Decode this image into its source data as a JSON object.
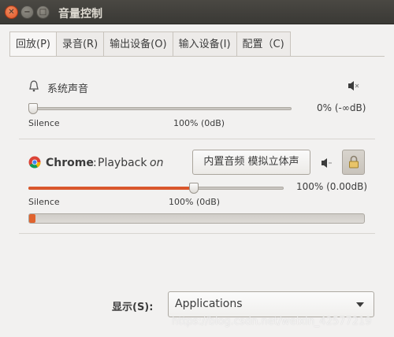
{
  "window": {
    "title": "音量控制"
  },
  "tabs": [
    {
      "label": "回放(P)",
      "active": true
    },
    {
      "label": "录音(R)",
      "active": false
    },
    {
      "label": "输出设备(O)",
      "active": false
    },
    {
      "label": "输入设备(I)",
      "active": false
    },
    {
      "label": "配置（C)",
      "active": false
    }
  ],
  "system_sound": {
    "label": "系统声音",
    "icon": "bell-icon",
    "volume_text": "0% (-∞dB)",
    "volume_fraction": 0.0,
    "silence_label": "Silence",
    "mark_label": "100% (0dB)",
    "mute_icon": "speaker-icon"
  },
  "chrome_stream": {
    "app_name": "Chrome",
    "separator": ":",
    "stream": "Playback",
    "state": "on",
    "device_button": "内置音频 模拟立体声",
    "volume_text": "100% (0.00dB)",
    "volume_fraction": 1.0,
    "silence_label": "Silence",
    "mark_label": "100% (0dB)",
    "level_fraction": 0.02,
    "icons": [
      "chrome-icon",
      "speaker-icon",
      "lock-icon"
    ]
  },
  "footer": {
    "show_label": "显示(S):",
    "show_value": "Applications"
  },
  "watermark": "https://blog.csdn.net/weixin_42577219",
  "colors": {
    "accent": "#d9572c",
    "titlebar": "#3c3b37"
  }
}
